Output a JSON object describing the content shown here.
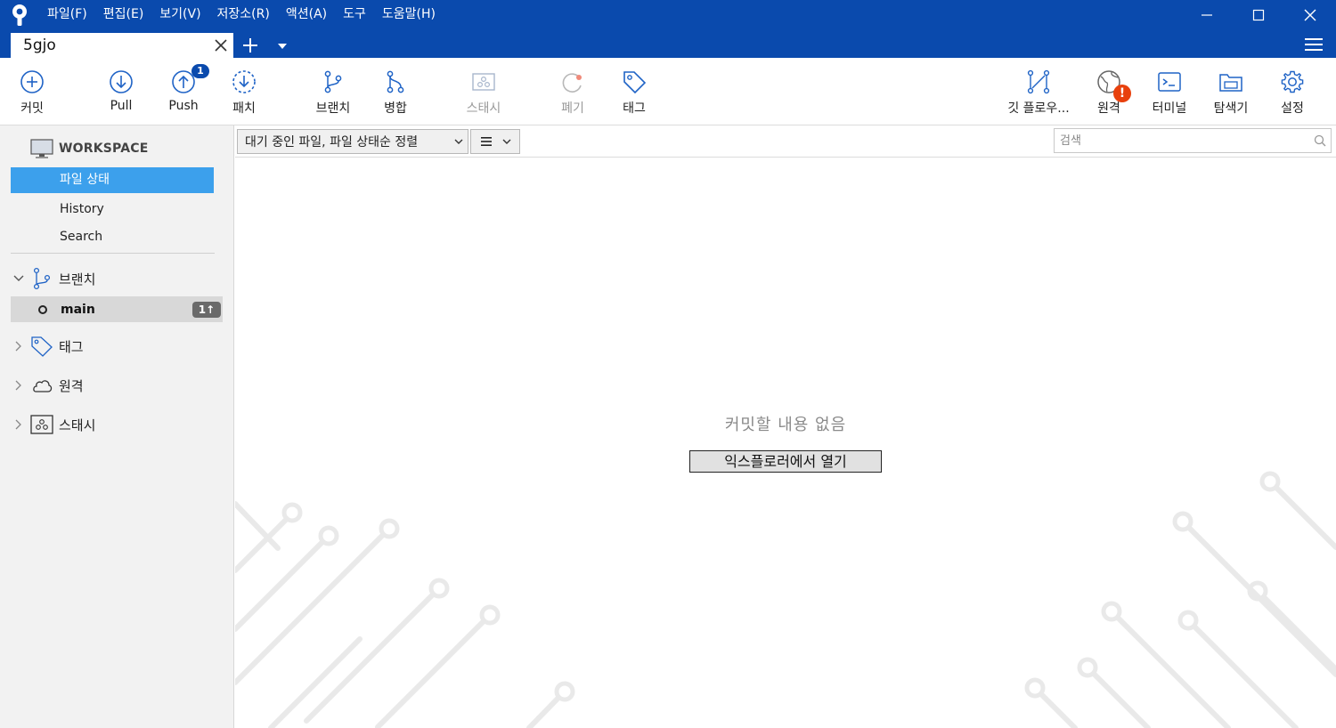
{
  "menu": {
    "items": [
      "파일(F)",
      "편집(E)",
      "보기(V)",
      "저장소(R)",
      "액션(A)",
      "도구",
      "도움말(H)"
    ]
  },
  "tab": {
    "title": "5gjo"
  },
  "toolbar": {
    "commit": "커밋",
    "pull": "Pull",
    "push": "Push",
    "push_badge": "1",
    "fetch": "패치",
    "branch": "브랜치",
    "merge": "병합",
    "stash": "스태시",
    "discard": "폐기",
    "tag": "태그",
    "gitflow": "깃 플로우...",
    "remote": "원격",
    "remote_alert": "!",
    "terminal": "터미널",
    "explorer": "탐색기",
    "settings": "설정"
  },
  "sidebar": {
    "workspace": "WORKSPACE",
    "items": [
      "파일 상태",
      "History",
      "Search"
    ],
    "branches_label": "브랜치",
    "branch_name": "main",
    "branch_ahead": "1↑",
    "tags_label": "태그",
    "remotes_label": "원격",
    "stashes_label": "스태시"
  },
  "filter": {
    "sort_label": "대기 중인 파일, 파일 상태순 정렬",
    "search_placeholder": "검색"
  },
  "main": {
    "empty_message": "커밋할 내용 없음",
    "open_explorer": "익스플로러에서 열기"
  },
  "colors": {
    "titlebar": "#0a4aad",
    "accent": "#3ca0ec",
    "sidebar_bg": "#f2f2f2",
    "alert": "#e8400c"
  }
}
